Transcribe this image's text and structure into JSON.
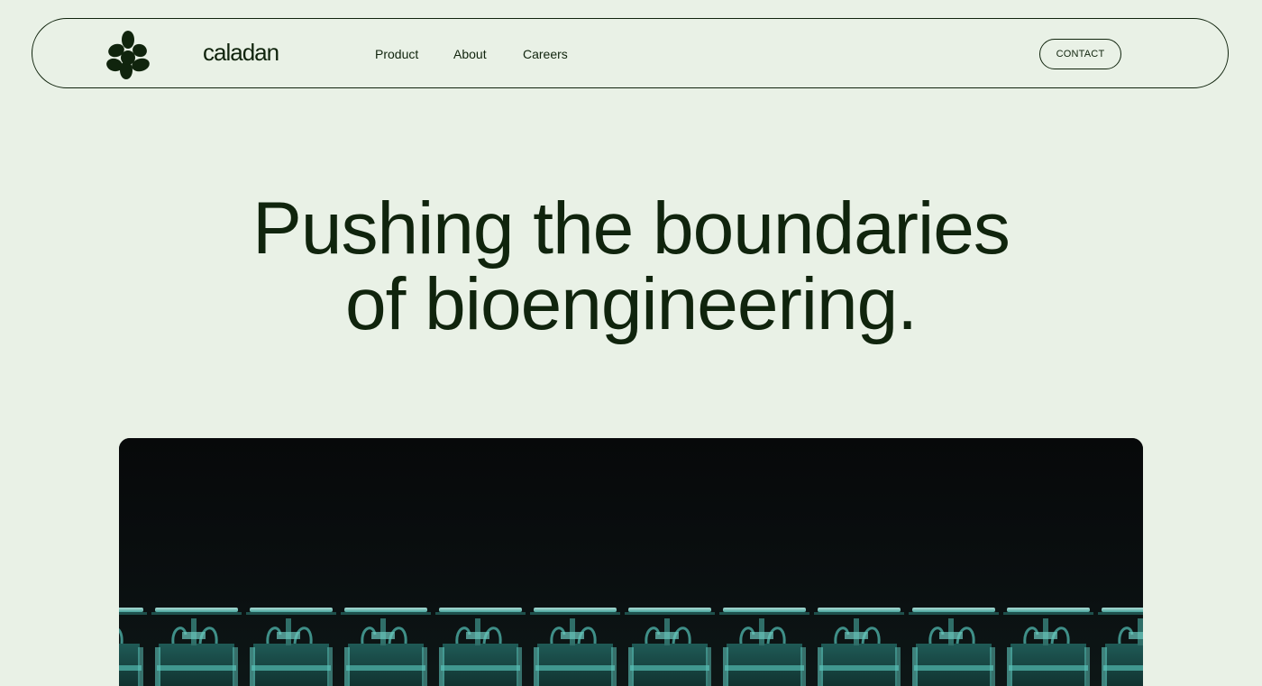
{
  "header": {
    "brand": "caladan",
    "logo_icon": "clover-logo-icon",
    "nav": [
      {
        "label": "Product"
      },
      {
        "label": "About"
      },
      {
        "label": "Careers"
      }
    ],
    "contact_label": "CONTACT"
  },
  "hero": {
    "line1": "Pushing the boundaries",
    "line2": "of bioengineering.",
    "image_icon": "lab-equipment-photo"
  },
  "colors": {
    "background": "#e9f1e6",
    "text": "#10240d",
    "image_bg": "#080b0b",
    "accent_teal": "#5fc9bf"
  }
}
